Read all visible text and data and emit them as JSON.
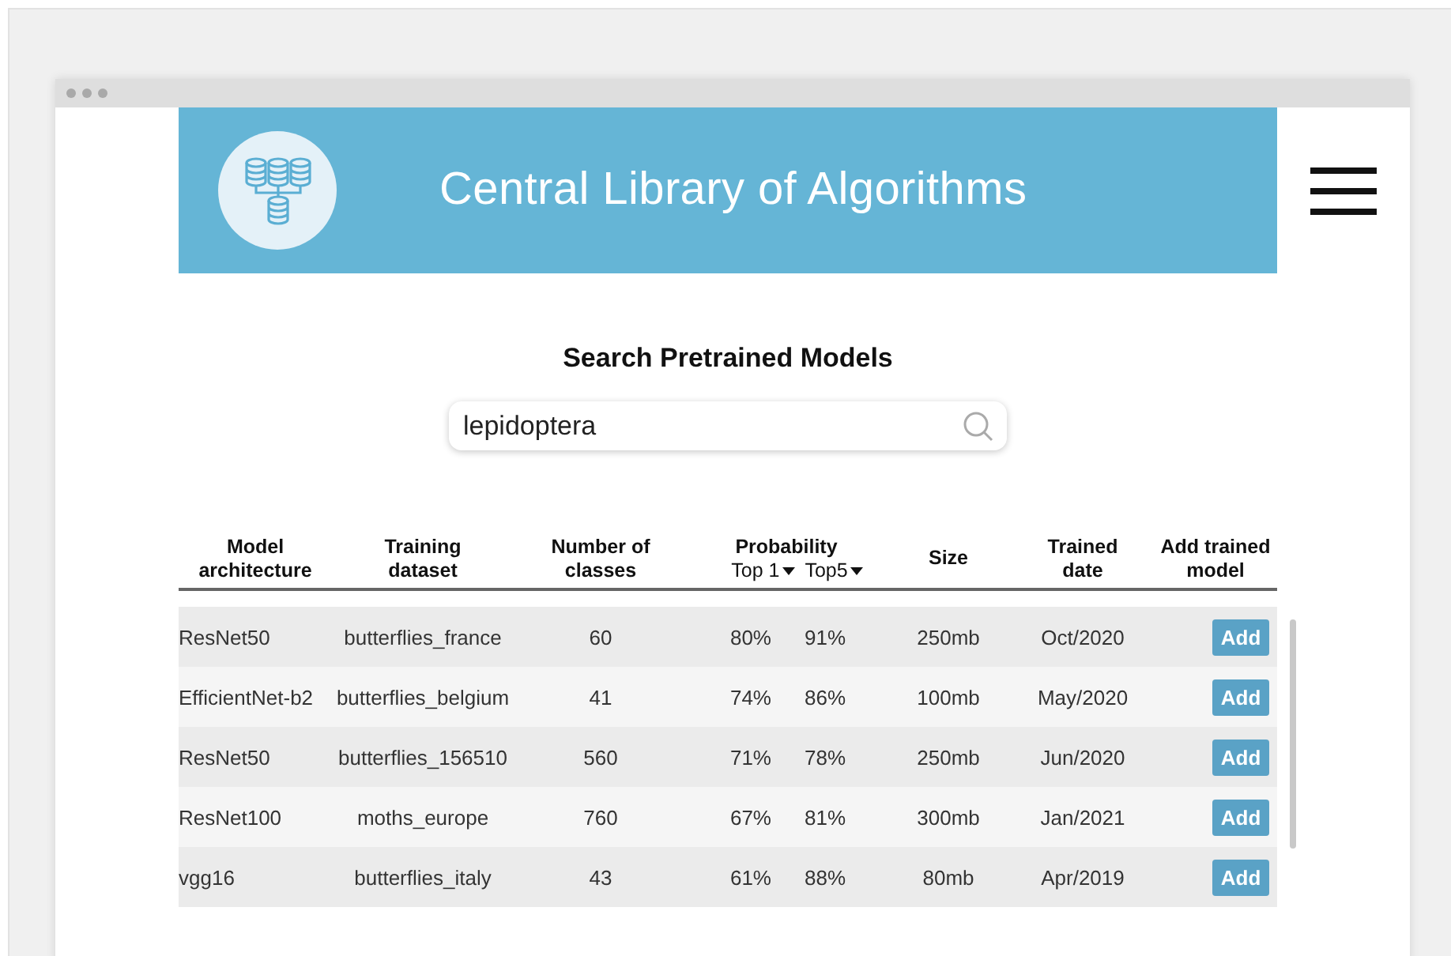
{
  "header": {
    "title": "Central Library of Algorithms"
  },
  "search": {
    "heading": "Search Pretrained Models",
    "value": "lepidoptera"
  },
  "table": {
    "columns": [
      {
        "label": "Model architecture"
      },
      {
        "label": "Training dataset"
      },
      {
        "label": "Number of classes"
      },
      {
        "label": "Probability",
        "sub": [
          "Top 1",
          "Top5"
        ]
      },
      {
        "label": "Size"
      },
      {
        "label": "Trained date"
      },
      {
        "label": "Add trained model"
      }
    ],
    "rows": [
      {
        "model": "ResNet50",
        "dataset": "butterflies_france",
        "classes": "60",
        "top1": "80%",
        "top5": "91%",
        "size": "250mb",
        "date": "Oct/2020",
        "action": "Add"
      },
      {
        "model": "EfficientNet-b2",
        "dataset": "butterflies_belgium",
        "classes": "41",
        "top1": "74%",
        "top5": "86%",
        "size": "100mb",
        "date": "May/2020",
        "action": "Add"
      },
      {
        "model": "ResNet50",
        "dataset": "butterflies_156510",
        "classes": "560",
        "top1": "71%",
        "top5": "78%",
        "size": "250mb",
        "date": "Jun/2020",
        "action": "Add"
      },
      {
        "model": "ResNet100",
        "dataset": "moths_europe",
        "classes": "760",
        "top1": "67%",
        "top5": "81%",
        "size": "300mb",
        "date": "Jan/2021",
        "action": "Add"
      },
      {
        "model": "vgg16",
        "dataset": "butterflies_italy",
        "classes": "43",
        "top1": "61%",
        "top5": "88%",
        "size": "80mb",
        "date": "Apr/2019",
        "action": "Add"
      }
    ]
  }
}
